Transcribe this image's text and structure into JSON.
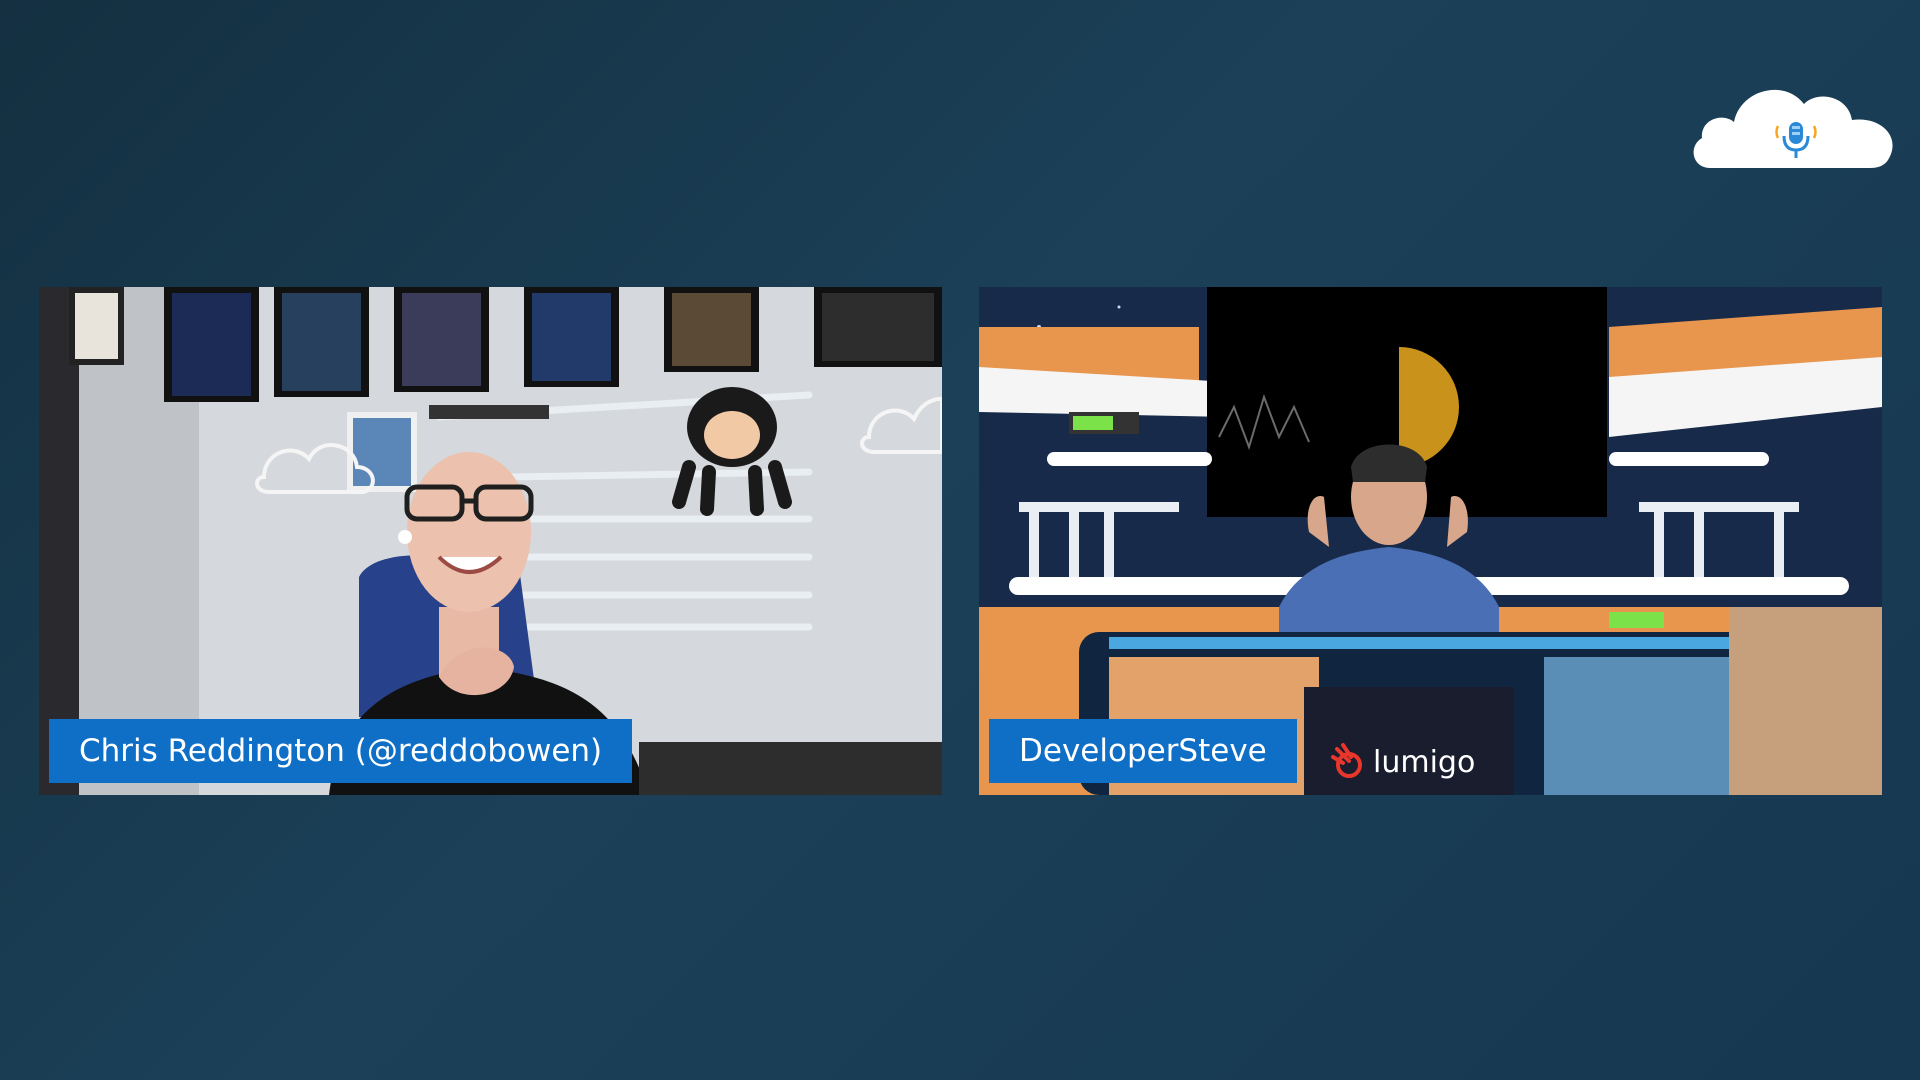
{
  "show": {
    "logo_icon": "microphone-cloud-icon",
    "colors": {
      "background_dark": "#143041",
      "background_light": "#1b4058",
      "name_tag": "#0f6fc6",
      "cloud": "#ffffff"
    }
  },
  "participants": [
    {
      "name": "Chris Reddington (@reddobowen)"
    },
    {
      "name": "DeveloperSteve",
      "brand": "lumigo"
    }
  ]
}
